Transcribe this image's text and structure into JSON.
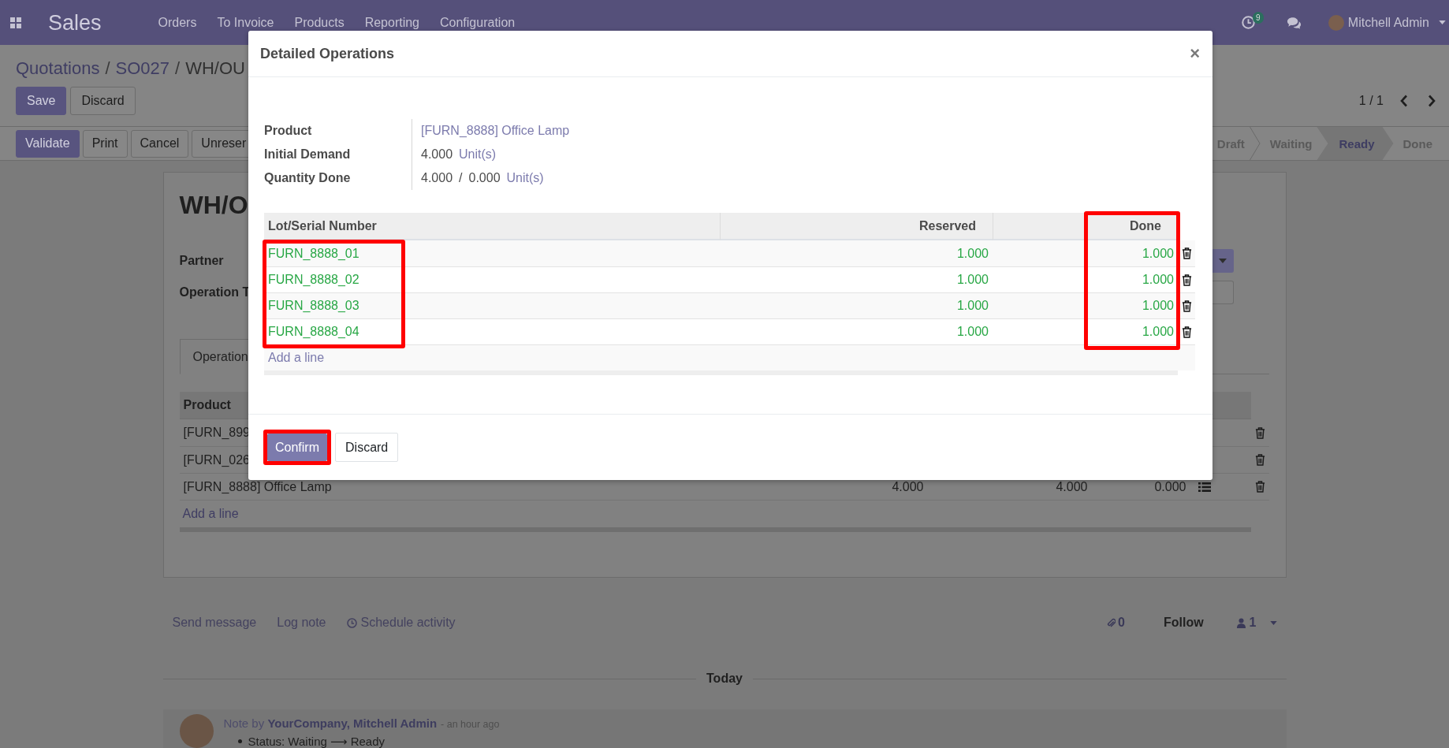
{
  "navbar": {
    "app_name": "Sales",
    "menu": [
      "Orders",
      "To Invoice",
      "Products",
      "Reporting",
      "Configuration"
    ],
    "activity_count": "9",
    "user_name": "Mitchell Admin"
  },
  "breadcrumbs": [
    {
      "label": "Quotations",
      "kind": "link"
    },
    {
      "label": "/",
      "kind": "separator"
    },
    {
      "label": "SO027",
      "kind": "link"
    },
    {
      "label": "/",
      "kind": "separator"
    },
    {
      "label": "WH/OU",
      "kind": "current"
    }
  ],
  "form_buttons": [
    {
      "label": "Save",
      "kind": "primary"
    },
    {
      "label": "Discard",
      "kind": "secondary"
    }
  ],
  "pager": "1 / 1",
  "header_buttons": [
    {
      "label": "Validate",
      "kind": "primary"
    },
    {
      "label": "Print",
      "kind": "secondary"
    },
    {
      "label": "Cancel",
      "kind": "secondary"
    },
    {
      "label": "Unreser",
      "kind": "secondary"
    }
  ],
  "status_steps": [
    {
      "label": "Draft",
      "selected": false
    },
    {
      "label": "Waiting",
      "selected": false
    },
    {
      "label": "Ready",
      "selected": true
    },
    {
      "label": "Done",
      "selected": false
    }
  ],
  "sheet": {
    "title": "WH/O",
    "fields": [
      {
        "label": "Partner"
      },
      {
        "label": "Operation T"
      }
    ],
    "side_controls": [
      {
        "kind": "dropdown"
      },
      {
        "kind": "input"
      }
    ],
    "tabs": [
      {
        "label": "Operation",
        "selected": true
      }
    ],
    "table": {
      "columns": [
        "Product"
      ],
      "rows": [
        {
          "cells": [
            "[FURN_899"
          ]
        },
        {
          "cells": [
            "[FURN_026"
          ]
        },
        {
          "cells": [
            "[FURN_8888] Office Lamp",
            "4.000",
            "4.000",
            "0.000"
          ],
          "detail_button": true
        }
      ],
      "add_line": "Add a line"
    }
  },
  "chatter": {
    "actions": [
      {
        "label": "Send message",
        "kind": "link"
      },
      {
        "label": "Log note",
        "kind": "link"
      },
      {
        "label": "Schedule activity",
        "kind": "activity"
      }
    ],
    "attachment_count": "0",
    "follow": "Follow",
    "follower_count": "1",
    "date_divider": "Today",
    "messages": [
      {
        "author_line": "Note by **YourCompany, Mitchell Admin**",
        "time": "- an hour ago",
        "changes": [
          "Status: Waiting ⟶ Ready"
        ]
      }
    ]
  },
  "modal": {
    "title": "Detailed Operations",
    "close": "×",
    "fields": [
      {
        "label": "Product",
        "parts": [
          {
            "text": "[FURN_8888] Office Lamp",
            "kind": "link"
          }
        ]
      },
      {
        "label": "Initial Demand",
        "parts": [
          {
            "text": "4.000",
            "kind": "plain"
          },
          {
            "text": "Unit(s)",
            "kind": "link"
          }
        ]
      },
      {
        "label": "Quantity Done",
        "parts": [
          {
            "text": "4.000",
            "kind": "plain"
          },
          {
            "text": "/",
            "kind": "plain"
          },
          {
            "text": "0.000",
            "kind": "plain"
          },
          {
            "text": "Unit(s)",
            "kind": "link"
          }
        ]
      }
    ],
    "table": {
      "columns": [
        {
          "label": "Lot/Serial Number",
          "kind": "text",
          "highlighted": true,
          "header_highlighted": false
        },
        {
          "label": "Reserved",
          "kind": "number",
          "highlighted": false
        },
        {
          "label": "Done",
          "kind": "number",
          "highlighted": true,
          "header_highlighted": true
        }
      ],
      "rows": [
        [
          "FURN_8888_01",
          "1.000",
          "1.000"
        ],
        [
          "FURN_8888_02",
          "1.000",
          "1.000"
        ],
        [
          "FURN_8888_03",
          "1.000",
          "1.000"
        ],
        [
          "FURN_8888_04",
          "1.000",
          "1.000"
        ]
      ],
      "add_line": "Add a line"
    },
    "buttons": [
      {
        "label": "Confirm",
        "kind": "primary",
        "highlighted": true
      },
      {
        "label": "Discard",
        "kind": "secondary",
        "highlighted": false
      }
    ]
  }
}
